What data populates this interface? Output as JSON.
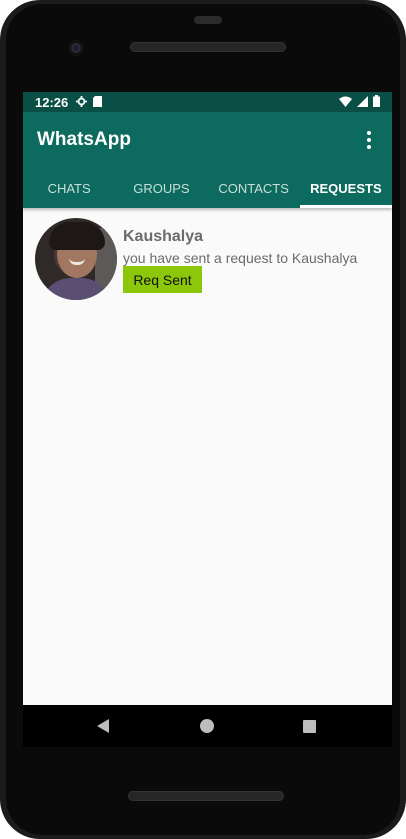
{
  "status_bar": {
    "time": "12:26"
  },
  "app_bar": {
    "title": "WhatsApp",
    "menu_icon": "more-vertical-icon"
  },
  "tabs": [
    {
      "label": "CHATS",
      "active": false
    },
    {
      "label": "GROUPS",
      "active": false
    },
    {
      "label": "CONTACTS",
      "active": false
    },
    {
      "label": "REQUESTS",
      "active": true
    }
  ],
  "requests": [
    {
      "name": "Kaushalya",
      "status": "you have sent a request to Kaushalya",
      "button_label": "Req Sent"
    }
  ],
  "colors": {
    "primary": "#0c6b5e",
    "status_bar": "#0a4f45",
    "button": "#8cc70a"
  },
  "nav_bar": {
    "back_icon": "back-triangle-icon",
    "home_icon": "home-circle-icon",
    "recent_icon": "recent-square-icon"
  }
}
